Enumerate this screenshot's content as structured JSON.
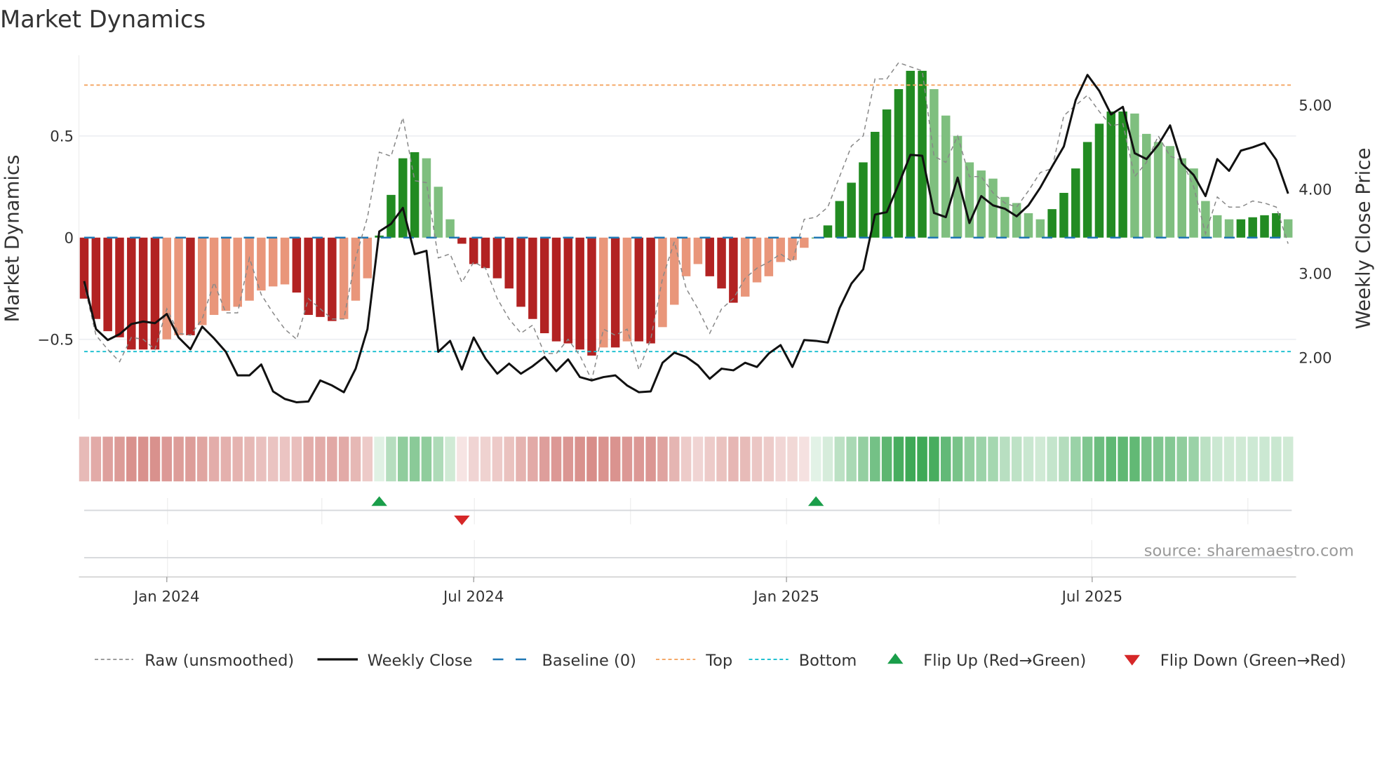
{
  "chart_data": {
    "type": "bar",
    "title": "Market Dynamics",
    "ylabel": "Market Dynamics",
    "ylabel_right": "Weekly Close Price",
    "ylim": [
      -0.9,
      0.9
    ],
    "ylim_right": [
      1.2,
      5.6
    ],
    "yticks": [
      {
        "v": 0.5,
        "label": "0.5"
      },
      {
        "v": 0,
        "label": "0"
      },
      {
        "v": -0.5,
        "label": "−0.5"
      }
    ],
    "yticks_right": [
      {
        "v": 5,
        "label": "5.00"
      },
      {
        "v": 4,
        "label": "4.00"
      },
      {
        "v": 3,
        "label": "3.00"
      },
      {
        "v": 2,
        "label": "2.00"
      }
    ],
    "xticks": [
      {
        "week": 7,
        "label": "Jan 2024"
      },
      {
        "week": 33,
        "label": "Jul 2024"
      },
      {
        "week": 59.5,
        "label": "Jan 2025"
      },
      {
        "week": 85.4,
        "label": "Jul 2025"
      }
    ],
    "top": 0.75,
    "bottom": -0.56,
    "baseline": 0,
    "values": [
      -0.3,
      -0.4,
      -0.46,
      -0.49,
      -0.55,
      -0.55,
      -0.55,
      -0.5,
      -0.48,
      -0.48,
      -0.43,
      -0.38,
      -0.36,
      -0.34,
      -0.31,
      -0.26,
      -0.24,
      -0.23,
      -0.27,
      -0.38,
      -0.39,
      -0.41,
      -0.4,
      -0.31,
      -0.2,
      0.01,
      0.21,
      0.39,
      0.42,
      0.39,
      0.25,
      0.09,
      -0.03,
      -0.13,
      -0.15,
      -0.2,
      -0.25,
      -0.34,
      -0.4,
      -0.47,
      -0.51,
      -0.52,
      -0.55,
      -0.58,
      -0.54,
      -0.54,
      -0.51,
      -0.51,
      -0.52,
      -0.44,
      -0.33,
      -0.19,
      -0.13,
      -0.19,
      -0.25,
      -0.32,
      -0.29,
      -0.22,
      -0.19,
      -0.12,
      -0.11,
      -0.05,
      0.0,
      0.06,
      0.18,
      0.27,
      0.37,
      0.52,
      0.63,
      0.73,
      0.82,
      0.82,
      0.73,
      0.6,
      0.5,
      0.37,
      0.33,
      0.29,
      0.2,
      0.17,
      0.12,
      0.09,
      0.14,
      0.22,
      0.34,
      0.47,
      0.56,
      0.62,
      0.62,
      0.61,
      0.51,
      0.47,
      0.45,
      0.39,
      0.34,
      0.18,
      0.11,
      0.09,
      0.09,
      0.1,
      0.11,
      0.12,
      0.09
    ],
    "raw": [
      -0.23,
      -0.48,
      -0.55,
      -0.61,
      -0.49,
      -0.5,
      -0.55,
      -0.35,
      -0.47,
      -0.48,
      -0.4,
      -0.22,
      -0.37,
      -0.37,
      -0.1,
      -0.28,
      -0.37,
      -0.45,
      -0.5,
      -0.3,
      -0.35,
      -0.4,
      -0.4,
      -0.1,
      0.1,
      0.42,
      0.4,
      0.59,
      0.28,
      0.27,
      -0.1,
      -0.08,
      -0.22,
      -0.12,
      -0.15,
      -0.3,
      -0.4,
      -0.47,
      -0.43,
      -0.57,
      -0.57,
      -0.5,
      -0.58,
      -0.7,
      -0.45,
      -0.48,
      -0.45,
      -0.65,
      -0.5,
      -0.2,
      -0.02,
      -0.25,
      -0.35,
      -0.47,
      -0.35,
      -0.3,
      -0.2,
      -0.15,
      -0.12,
      -0.08,
      -0.12,
      0.09,
      0.1,
      0.15,
      0.3,
      0.45,
      0.5,
      0.78,
      0.78,
      0.86,
      0.84,
      0.82,
      0.4,
      0.37,
      0.5,
      0.3,
      0.3,
      0.22,
      0.17,
      0.15,
      0.23,
      0.32,
      0.34,
      0.6,
      0.65,
      0.7,
      0.62,
      0.55,
      0.56,
      0.3,
      0.37,
      0.5,
      0.4,
      0.38,
      0.25,
      0.02,
      0.2,
      0.15,
      0.15,
      0.18,
      0.17,
      0.15,
      -0.03
    ],
    "close": [
      2.9,
      2.33,
      2.2,
      2.27,
      2.39,
      2.42,
      2.4,
      2.51,
      2.23,
      2.09,
      2.36,
      2.22,
      2.06,
      1.78,
      1.78,
      1.91,
      1.59,
      1.5,
      1.46,
      1.47,
      1.72,
      1.66,
      1.58,
      1.86,
      2.33,
      3.49,
      3.58,
      3.77,
      3.22,
      3.26,
      2.06,
      2.19,
      1.85,
      2.23,
      1.98,
      1.8,
      1.92,
      1.8,
      1.89,
      2.0,
      1.83,
      1.97,
      1.76,
      1.72,
      1.76,
      1.78,
      1.66,
      1.58,
      1.59,
      1.93,
      2.05,
      2.0,
      1.9,
      1.74,
      1.86,
      1.84,
      1.93,
      1.88,
      2.04,
      2.14,
      1.88,
      2.2,
      2.19,
      2.17,
      2.58,
      2.87,
      3.04,
      3.69,
      3.72,
      4.05,
      4.4,
      4.39,
      3.71,
      3.66,
      4.13,
      3.59,
      3.91,
      3.8,
      3.76,
      3.67,
      3.8,
      4.01,
      4.26,
      4.5,
      5.05,
      5.35,
      5.16,
      4.88,
      4.97,
      4.42,
      4.35,
      4.52,
      4.75,
      4.3,
      4.16,
      3.91,
      4.35,
      4.21,
      4.45,
      4.49,
      4.54,
      4.34,
      3.94
    ],
    "flip_up_weeks": [
      25,
      62
    ],
    "flip_down_weeks": [
      32
    ],
    "legend": [
      "Raw (unsmoothed)",
      "Weekly Close",
      "Baseline (0)",
      "Top",
      "Bottom",
      "Flip Up (Red→Green)",
      "Flip Down (Green→Red)"
    ],
    "legend_placement": "bottom",
    "source": "source: sharemaestro.com",
    "colors": {
      "strong_down": "#b22222",
      "weak_down": "#e9967a",
      "strong_up": "#228b22",
      "weak_up": "#7fbf7f",
      "close": "#111111",
      "raw": "#888888",
      "baseline": "#1f77b4",
      "top": "#f4a460",
      "bottom": "#17becf",
      "flip_up": "#1a9e4a",
      "flip_down": "#d62728"
    }
  }
}
